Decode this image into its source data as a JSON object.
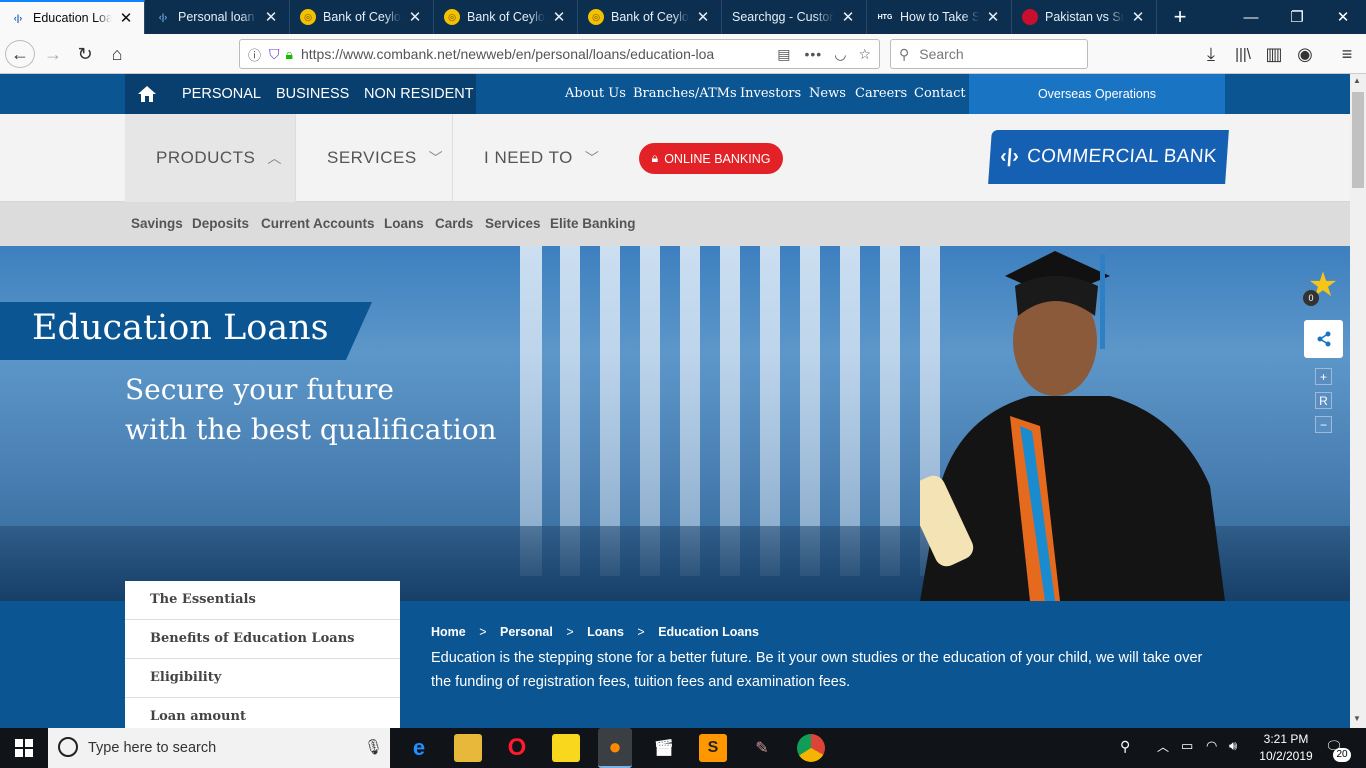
{
  "browser": {
    "tabs": [
      {
        "title": "Education Loan",
        "active": true
      },
      {
        "title": "Personal loan | ",
        "active": false
      },
      {
        "title": "Bank of Ceylon",
        "active": false
      },
      {
        "title": "Bank of Ceylon",
        "active": false
      },
      {
        "title": "Bank of Ceylon",
        "active": false
      },
      {
        "title": "Searchgg - Custom",
        "active": false
      },
      {
        "title": "How to Take Sc",
        "active": false
      },
      {
        "title": "Pakistan vs Sri L",
        "active": false
      }
    ],
    "url": "https://www.combank.net/newweb/en/personal/loans/education-loa",
    "search_placeholder": "Search",
    "htg_badge": "HTG"
  },
  "site": {
    "top_nav": [
      "PERSONAL",
      "BUSINESS",
      "NON RESIDENT"
    ],
    "right_links": [
      "About Us",
      "Branches/ATMs",
      "Investors",
      "News",
      "Careers",
      "Contact"
    ],
    "overseas": "Overseas Operations",
    "main_nav": [
      "PRODUCTS",
      "SERVICES",
      "I NEED TO"
    ],
    "online_banking": "ONLINE BANKING",
    "logo_text": "COMMERCIAL BANK",
    "sub_nav": [
      "Savings",
      "Deposits",
      "Current Accounts",
      "Loans",
      "Cards",
      "Services",
      "Elite Banking"
    ]
  },
  "hero": {
    "title": "Education Loans",
    "subtitle_line1": "Secure your future",
    "subtitle_line2": "with the best qualification"
  },
  "widgets": {
    "star_count": "0",
    "zoom_in": "+",
    "reset": "R",
    "zoom_out": "−"
  },
  "side_menu": [
    "The Essentials",
    "Benefits of Education Loans",
    "Eligibility",
    "Loan amount"
  ],
  "breadcrumb": [
    "Home",
    ">",
    "Personal",
    ">",
    "Loans",
    ">",
    "Education Loans"
  ],
  "intro": "Education is the stepping stone for a better future. Be it your own studies or the education of your child, we will take over the funding of registration fees, tuition fees and examination fees.",
  "taskbar": {
    "search_placeholder": "Type here to search",
    "time": "3:21 PM",
    "date": "10/2/2019",
    "notifications": "20"
  }
}
